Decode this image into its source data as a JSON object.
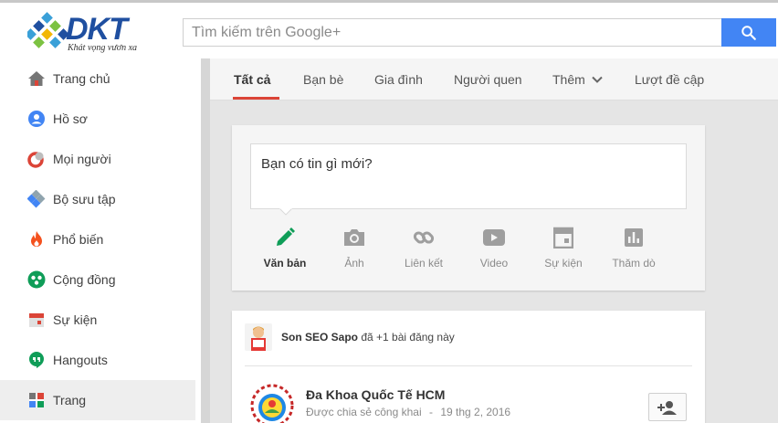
{
  "brand": {
    "logo_text": "DKT",
    "tagline": "Khát vọng vươn xa"
  },
  "search": {
    "placeholder": "Tìm kiếm trên Google+"
  },
  "sidebar": {
    "items": [
      {
        "label": "Trang chủ",
        "icon": "home-icon"
      },
      {
        "label": "Hồ sơ",
        "icon": "profile-icon"
      },
      {
        "label": "Mọi người",
        "icon": "people-icon"
      },
      {
        "label": "Bộ sưu tập",
        "icon": "collections-icon"
      },
      {
        "label": "Phổ biến",
        "icon": "flame-icon"
      },
      {
        "label": "Cộng đồng",
        "icon": "communities-icon"
      },
      {
        "label": "Sự kiện",
        "icon": "calendar-icon"
      },
      {
        "label": "Hangouts",
        "icon": "hangouts-icon"
      },
      {
        "label": "Trang",
        "icon": "pages-icon"
      }
    ],
    "active_index": 8
  },
  "tabs": {
    "items": [
      "Tất cả",
      "Bạn bè",
      "Gia đình",
      "Người quen",
      "Thêm",
      "Lượt đề cập"
    ],
    "active_index": 0
  },
  "share": {
    "prompt": "Bạn có tin gì mới?",
    "actions": [
      {
        "label": "Văn bản",
        "icon": "pencil-icon"
      },
      {
        "label": "Ảnh",
        "icon": "camera-icon"
      },
      {
        "label": "Liên kết",
        "icon": "link-icon"
      },
      {
        "label": "Video",
        "icon": "video-icon"
      },
      {
        "label": "Sự kiện",
        "icon": "event-icon"
      },
      {
        "label": "Thăm dò",
        "icon": "poll-icon"
      }
    ]
  },
  "post": {
    "plusone_user": "Son SEO Sapo",
    "plusone_text": "đã +1 bài đăng này",
    "author": "Đa Khoa Quốc Tế HCM",
    "visibility": "Được chia sẻ công khai",
    "separator": "-",
    "date": "19 thg 2, 2016"
  },
  "colors": {
    "accent": "#db4437",
    "search_button": "#4285f4",
    "logo_blue": "#1f4fa0"
  }
}
